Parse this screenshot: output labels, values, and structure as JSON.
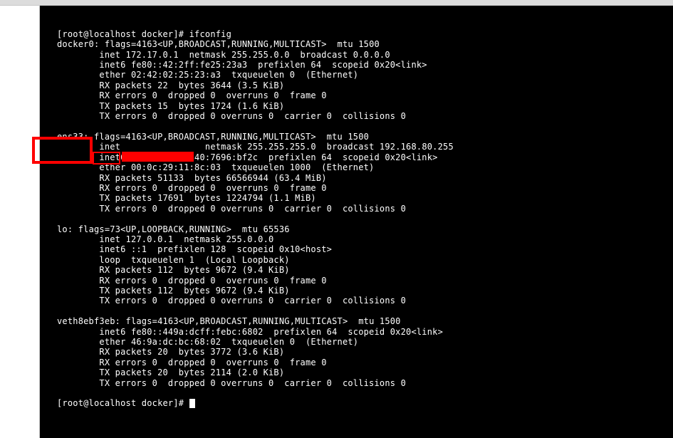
{
  "prompt1": "[root@localhost docker]# ",
  "command": "ifconfig",
  "docker0": {
    "name": "docker0",
    "header": "flags=4163<UP,BROADCAST,RUNNING,MULTICAST>  mtu 1500",
    "l1": "inet 172.17.0.1  netmask 255.255.0.0  broadcast 0.0.0.0",
    "l2": "inet6 fe80::42:2ff:fe25:23a3  prefixlen 64  scopeid 0x20<link>",
    "l3": "ether 02:42:02:25:23:a3  txqueuelen 0  (Ethernet)",
    "l4": "RX packets 22  bytes 3644 (3.5 KiB)",
    "l5": "RX errors 0  dropped 0  overruns 0  frame 0",
    "l6": "TX packets 15  bytes 1724 (1.6 KiB)",
    "l7": "TX errors 0  dropped 0 overruns 0  carrier 0  collisions 0"
  },
  "ens33": {
    "name": "ens33",
    "header": "flags=4163<UP,BROADCAST,RUNNING,MULTICAST>  mtu 1500",
    "inet_label": "inet",
    "inet_rest": " netmask 255.255.255.0  broadcast 192.168.80.255",
    "l2": "inet6 fe80::5cf:9740:7696:bf2c  prefixlen 64  scopeid 0x20<link>",
    "l3": "ether 00:0c:29:11:8c:03  txqueuelen 1000  (Ethernet)",
    "l4": "RX packets 51133  bytes 66566944 (63.4 MiB)",
    "l5": "RX errors 0  dropped 0  overruns 0  frame 0",
    "l6": "TX packets 17691  bytes 1224794 (1.1 MiB)",
    "l7": "TX errors 0  dropped 0 overruns 0  carrier 0  collisions 0"
  },
  "lo": {
    "name": "lo",
    "header": "flags=73<UP,LOOPBACK,RUNNING>  mtu 65536",
    "l1": "inet 127.0.0.1  netmask 255.0.0.0",
    "l2": "inet6 ::1  prefixlen 128  scopeid 0x10<host>",
    "l3": "loop  txqueuelen 1  (Local Loopback)",
    "l4": "RX packets 112  bytes 9672 (9.4 KiB)",
    "l5": "RX errors 0  dropped 0  overruns 0  frame 0",
    "l6": "TX packets 112  bytes 9672 (9.4 KiB)",
    "l7": "TX errors 0  dropped 0 overruns 0  carrier 0  collisions 0"
  },
  "veth": {
    "name": "veth8ebf3eb",
    "header": "flags=4163<UP,BROADCAST,RUNNING,MULTICAST>  mtu 1500",
    "l1": "inet6 fe80::449a:dcff:febc:6802  prefixlen 64  scopeid 0x20<link>",
    "l2": "ether 46:9a:dc:bc:68:02  txqueuelen 0  (Ethernet)",
    "l3": "RX packets 20  bytes 3772 (3.6 KiB)",
    "l4": "RX errors 0  dropped 0  overruns 0  frame 0",
    "l5": "TX packets 20  bytes 2114 (2.0 KiB)",
    "l6": "TX errors 0  dropped 0 overruns 0  carrier 0  collisions 0"
  },
  "prompt2": "[root@localhost docker]# "
}
